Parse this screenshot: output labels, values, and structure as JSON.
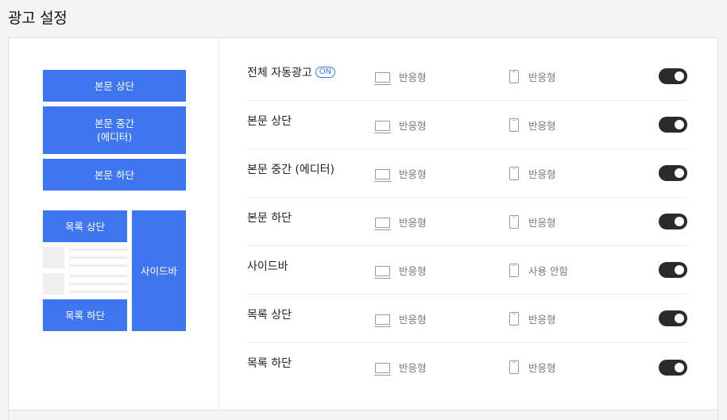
{
  "page": {
    "title": "광고 설정"
  },
  "preview": {
    "top": "본문 상단",
    "middle_line1": "본문 중간",
    "middle_line2": "(에디터)",
    "bottom": "본문 하단",
    "list_top": "목록 상단",
    "list_bottom": "목록 하단",
    "sidebar": "사이드바",
    "slot_color": "#3d76ef"
  },
  "settings": {
    "on_badge": "ON",
    "rows": [
      {
        "label": "전체 자동광고",
        "pc": "반응형",
        "mobile": "반응형",
        "enabled": true
      },
      {
        "label": "본문 상단",
        "pc": "반응형",
        "mobile": "반응형",
        "enabled": true
      },
      {
        "label": "본문 중간 (에디터)",
        "pc": "반응형",
        "mobile": "반응형",
        "enabled": true
      },
      {
        "label": "본문 하단",
        "pc": "반응형",
        "mobile": "반응형",
        "enabled": true
      },
      {
        "label": "사이드바",
        "pc": "반응형",
        "mobile": "사용 안함",
        "enabled": true
      },
      {
        "label": "목록 상단",
        "pc": "반응형",
        "mobile": "반응형",
        "enabled": true
      },
      {
        "label": "목록 하단",
        "pc": "반응형",
        "mobile": "반응형",
        "enabled": true
      }
    ],
    "icons": {
      "pc": "laptop-icon",
      "mobile": "smartphone-icon"
    },
    "toggle_color": "#2b2b2b"
  }
}
